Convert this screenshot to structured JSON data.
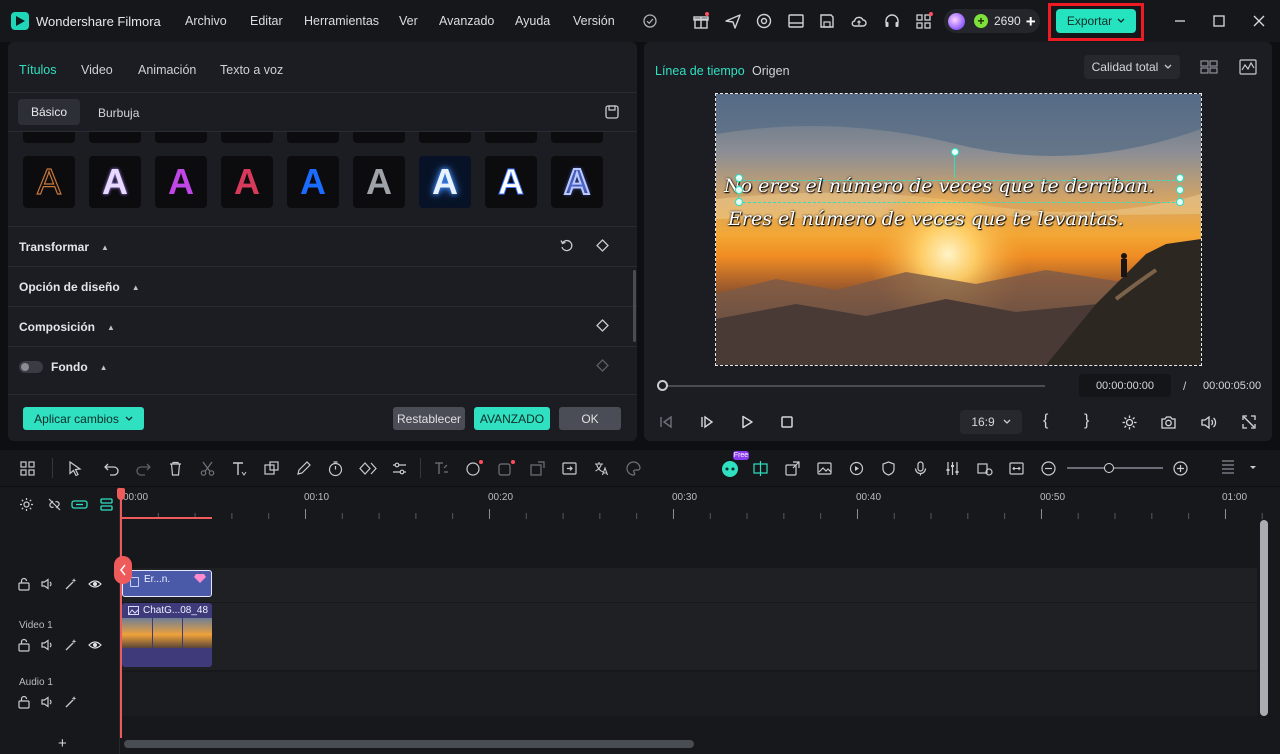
{
  "app": {
    "name": "Wondershare Filmora"
  },
  "menu": [
    "Archivo",
    "Editar",
    "Herramientas",
    "Ver",
    "Avanzado",
    "Ayuda",
    "Versión"
  ],
  "header": {
    "credits": "2690",
    "export_label": "Exportar"
  },
  "left_panel": {
    "tabs": [
      "Títulos",
      "Video",
      "Animación",
      "Texto a voz"
    ],
    "subtabs": [
      "Básico",
      "Burbuja"
    ],
    "tile_glyph": "A",
    "sections": [
      "Transformar",
      "Opción de diseño",
      "Composición",
      "Fondo"
    ],
    "buttons": {
      "apply": "Aplicar cambios",
      "reset": "Restablecer",
      "advanced": "AVANZADO",
      "ok": "OK"
    }
  },
  "preview_panel": {
    "tabs": [
      "Línea de tiempo",
      "Origen"
    ],
    "quality": "Calidad total",
    "caption_line1": "No eres el número de veces que te derriban.",
    "caption_line2": "Eres el número de veces que te levantas.",
    "time_current": "00:00:00:00",
    "time_separator": "/",
    "time_total": "00:00:05:00",
    "aspect": "16:9"
  },
  "timeline": {
    "ruler": [
      "00:00",
      "00:10",
      "00:20",
      "00:30",
      "00:40",
      "00:50",
      "01:00"
    ],
    "free_badge": "Free",
    "tracks": {
      "video": "Video 1",
      "audio": "Audio 1"
    },
    "clips": {
      "title": "Er...n.",
      "video": "ChatG...08_48"
    },
    "add": "+"
  },
  "colors": {
    "accent": "#26e3c0",
    "highlight": "#ee1b24",
    "playhead": "#ef5a5a"
  }
}
